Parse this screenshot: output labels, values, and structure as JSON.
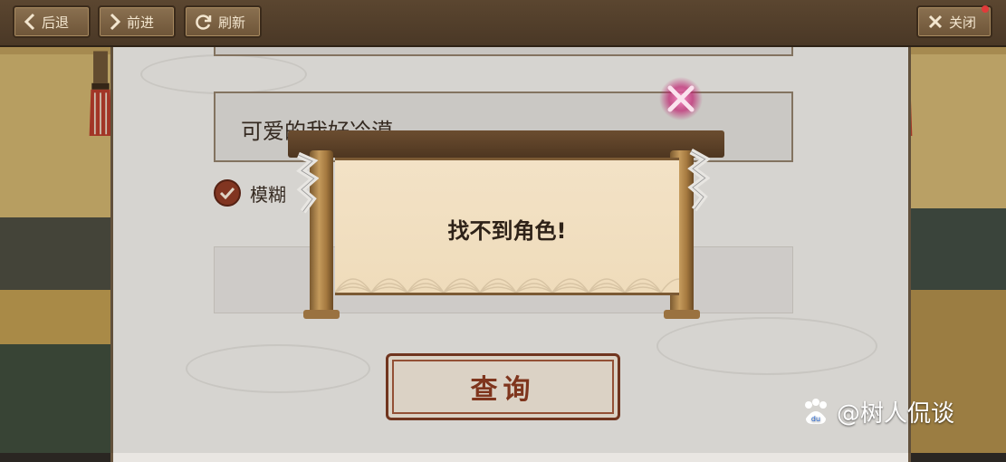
{
  "toolbar": {
    "back_label": "后退",
    "forward_label": "前进",
    "refresh_label": "刷新",
    "close_label": "关闭"
  },
  "form": {
    "name_value": "可爱的我好冷漠",
    "fuzzy_label": "模糊",
    "fuzzy_checked": true,
    "query_button": "查询"
  },
  "dialog": {
    "message": "找不到角色!"
  },
  "watermark": {
    "text": "@树人侃谈"
  },
  "colors": {
    "accent": "#8c3a24",
    "topbar": "#4a3826",
    "close_glow": "#e03a8a"
  }
}
